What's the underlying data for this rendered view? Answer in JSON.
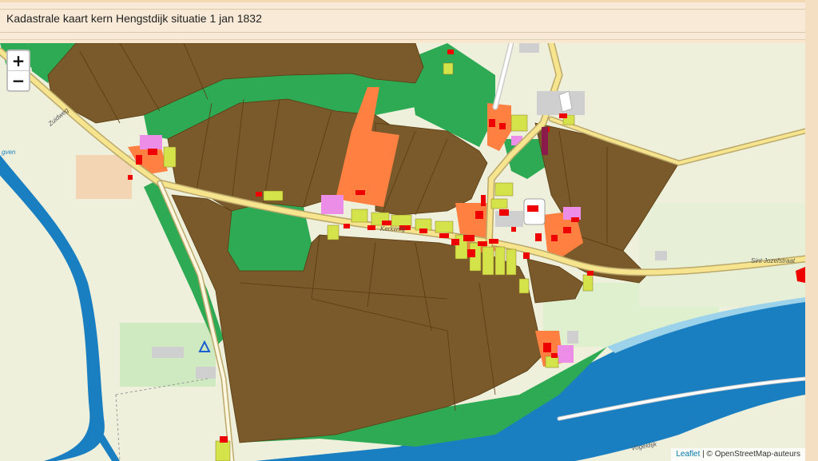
{
  "header": {
    "title": "Kadastrale kaart kern Hengstdijk situatie 1 jan 1832"
  },
  "zoom": {
    "in_label": "+",
    "out_label": "−"
  },
  "attribution": {
    "leaflet": "Leaflet",
    "separator": " | © ",
    "osm": "OpenStreetMap-auteurs"
  },
  "map_labels": {
    "zuidweg": "Zuidweg",
    "kerkweg": "Kerkweg",
    "sint_jozefstraat": "Sint Jozefstraat",
    "vogeldijk": "Vogeldijk",
    "gven": "gven"
  },
  "colors": {
    "parcel_farmland": "#7a5a2b",
    "parcel_grass": "#2eaa55",
    "parcel_orange": "#ff8040",
    "parcel_yellow": "#d4e34a",
    "parcel_pink": "#ec8ee8",
    "building_red": "#ee0000",
    "water": "#1a7fc1",
    "road": "#f6e58e"
  }
}
